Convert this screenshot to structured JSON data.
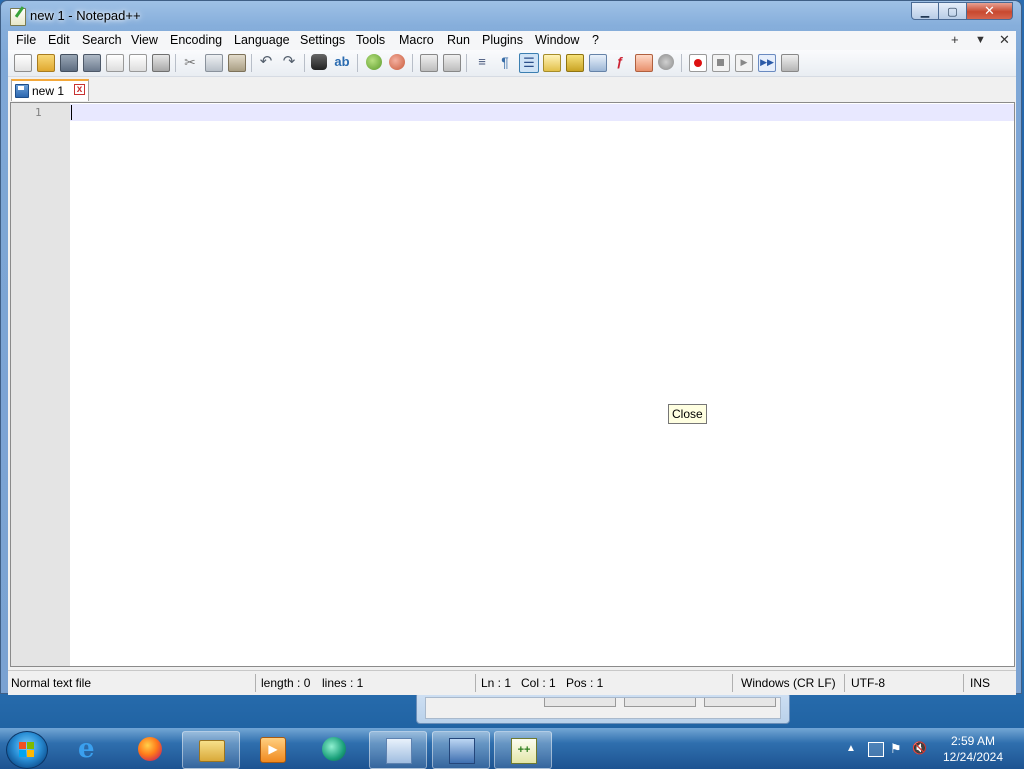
{
  "window": {
    "title": "new 1 - Notepad++"
  },
  "menubar": {
    "items": [
      "File",
      "Edit",
      "Search",
      "View",
      "Encoding",
      "Language",
      "Settings",
      "Tools",
      "Macro",
      "Run",
      "Plugins",
      "Window",
      "?"
    ],
    "right": {
      "plus": "+",
      "dropdown": "▼",
      "close": "✕"
    }
  },
  "tabs": [
    {
      "label": "new 1"
    }
  ],
  "editor": {
    "line_numbers": [
      "1"
    ]
  },
  "tooltip": {
    "text": "Close"
  },
  "statusbar": {
    "file_type": "Normal text file",
    "length": "length : 0",
    "lines": "lines : 1",
    "ln": "Ln : 1",
    "col": "Col : 1",
    "pos": "Pos : 1",
    "eol": "Windows (CR LF)",
    "encoding": "UTF-8",
    "mode": "INS"
  },
  "taskbar": {
    "apps": [
      "internet-explorer",
      "firefox",
      "file-explorer",
      "media-player",
      "media-center",
      "remote-desktop",
      "network",
      "notepad-plus-plus"
    ],
    "clock": {
      "time": "2:59 AM",
      "date": "12/24/2024"
    }
  },
  "colors": {
    "caret_line": "#e8e8ff",
    "gutter": "#e4e4e4",
    "tab_accent": "#f4a83a",
    "tooltip_bg": "#ffffe1",
    "taskbar": "#1d5391"
  }
}
